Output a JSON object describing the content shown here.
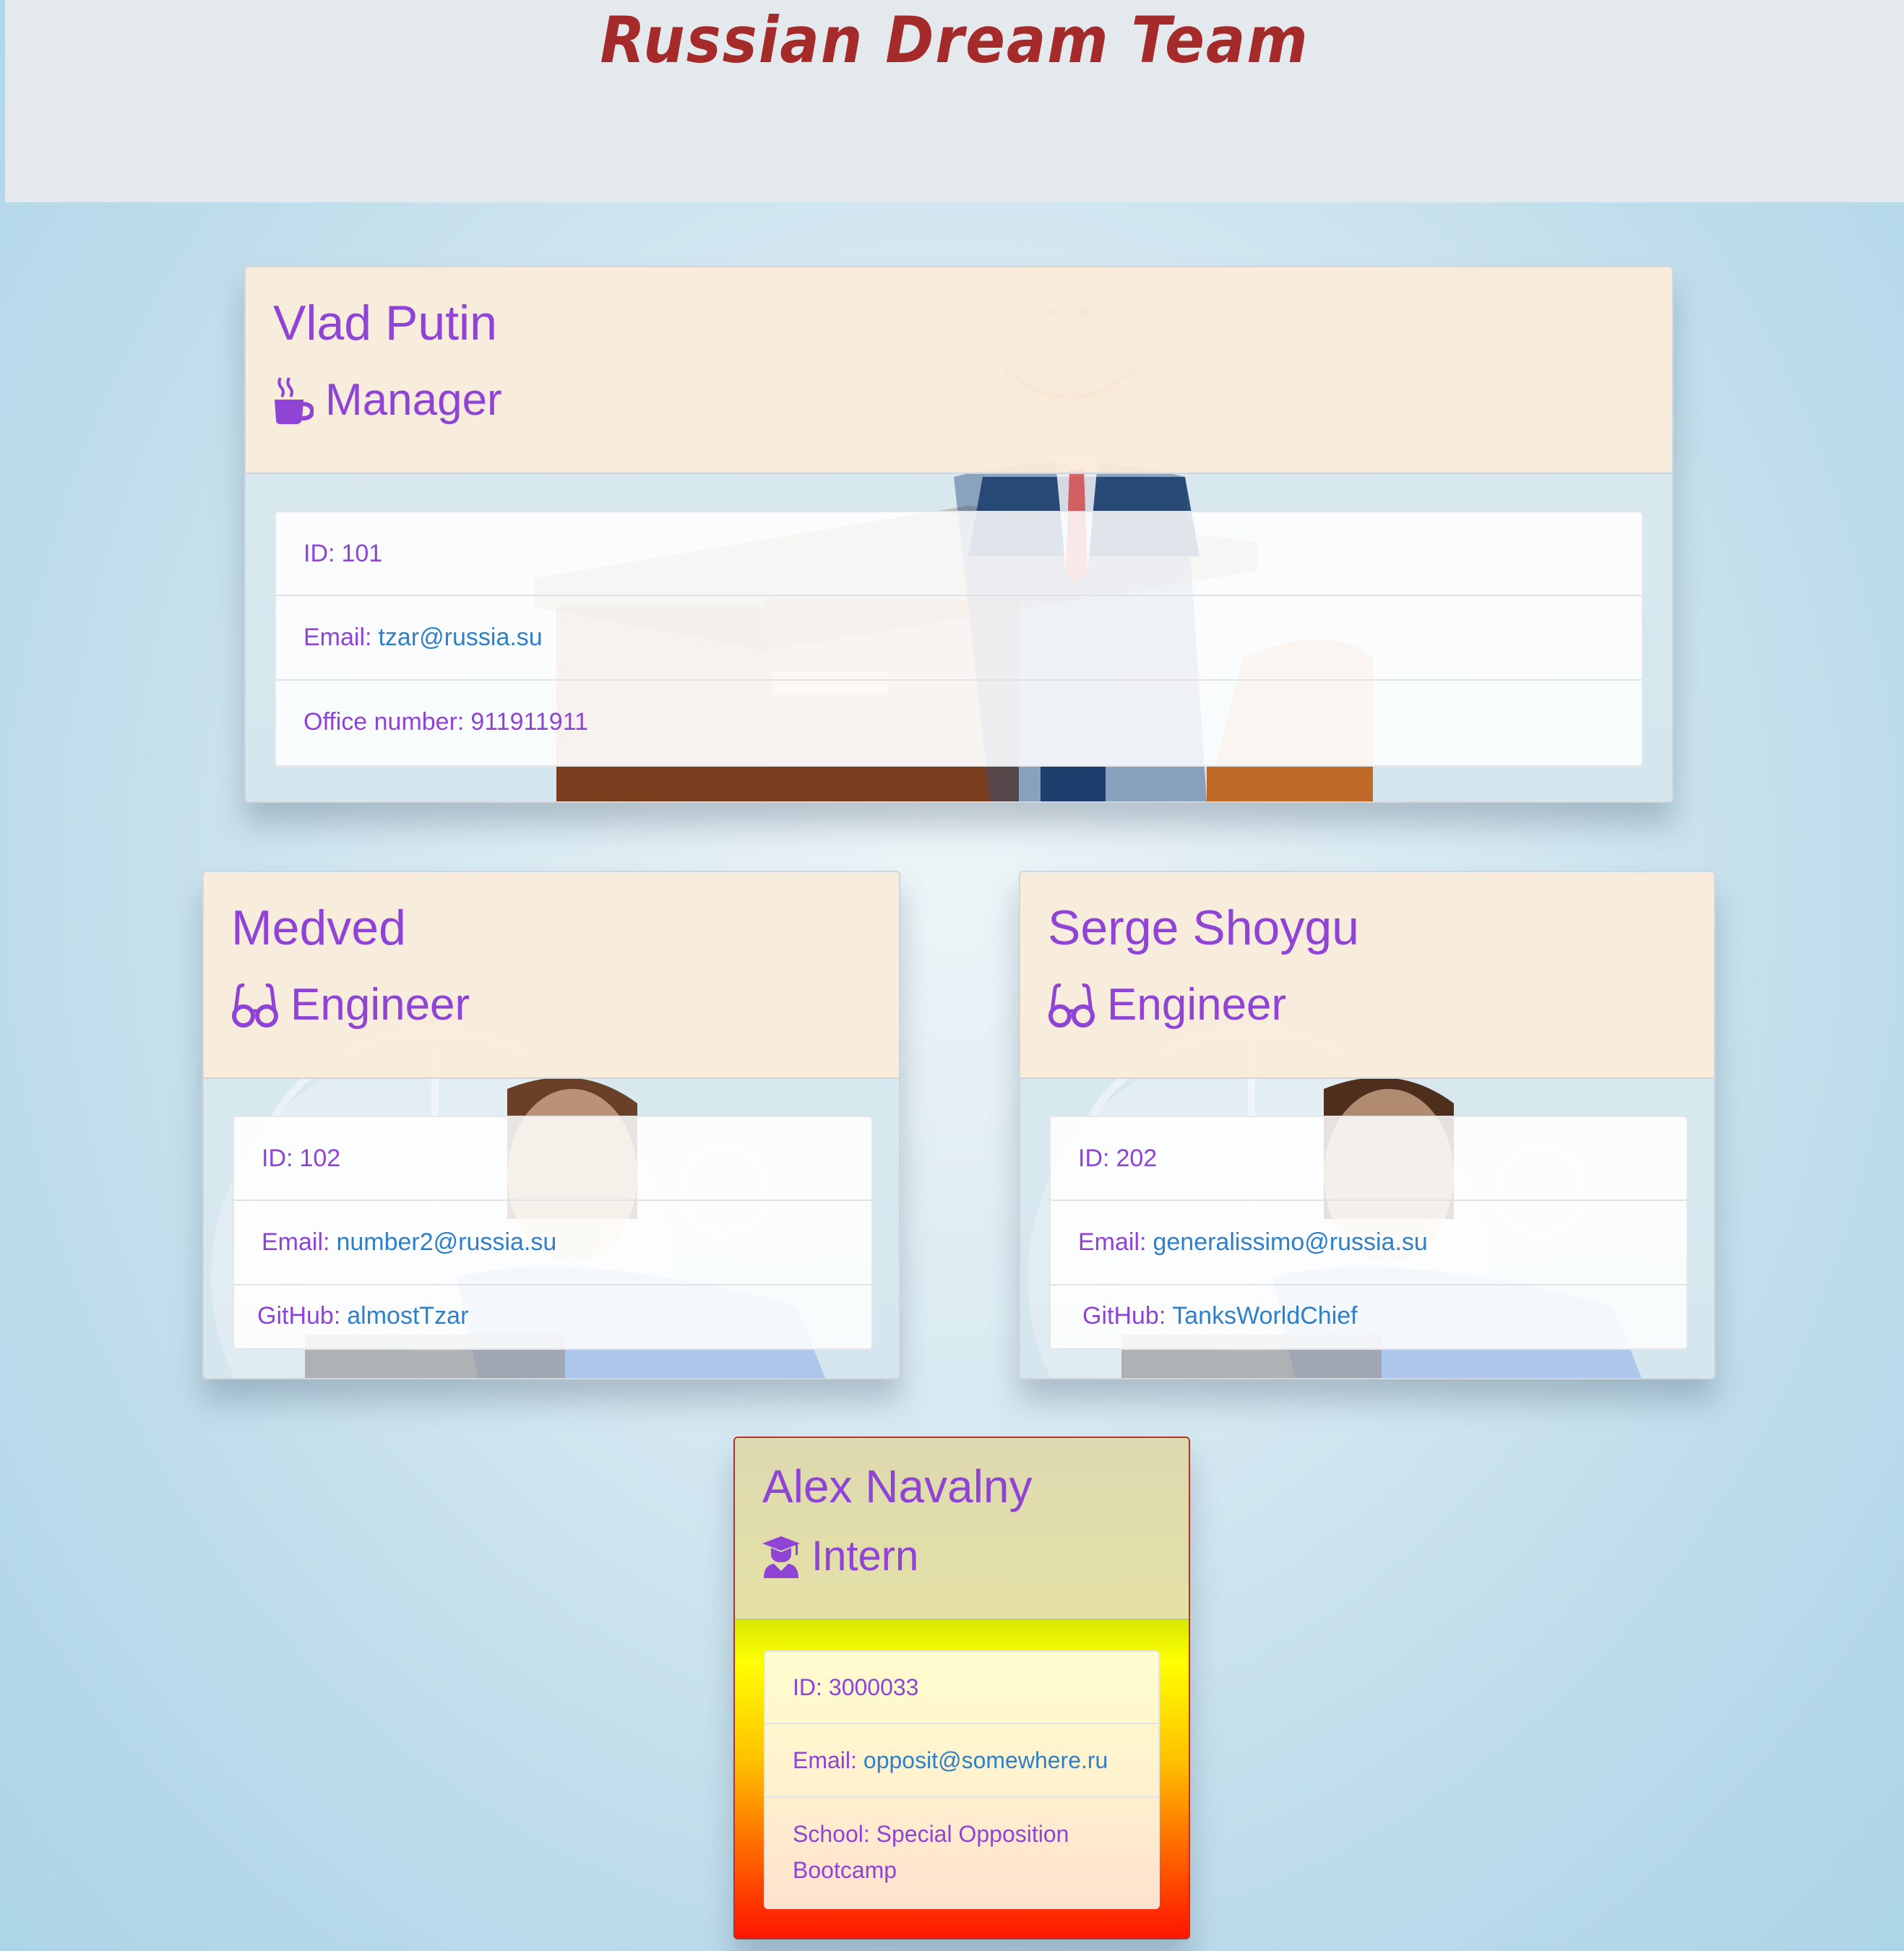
{
  "page_title": "Russian Dream Team",
  "colors": {
    "title": "#a52a2a",
    "name": "#8f44d6",
    "link": "#2f7fc9"
  },
  "cards": [
    {
      "name": "Vlad Putin",
      "role": "Manager",
      "role_icon": "mug-hot-icon",
      "id_label": "ID:",
      "id": "101",
      "email_label": "Email:",
      "email": "tzar@russia.su",
      "extra_label": "Office number:",
      "extra": "911911911"
    },
    {
      "name": "Medved",
      "role": "Engineer",
      "role_icon": "glasses-icon",
      "id_label": "ID:",
      "id": "102",
      "email_label": "Email:",
      "email": "number2@russia.su",
      "extra_label": "GitHub:",
      "extra": "almostTzar"
    },
    {
      "name": "Serge Shoygu",
      "role": "Engineer",
      "role_icon": "glasses-icon",
      "id_label": "ID:",
      "id": "202",
      "email_label": "Email:",
      "email": "generalissimo@russia.su",
      "extra_label": "GitHub:",
      "extra": "TanksWorldChief"
    },
    {
      "name": "Alex Navalny",
      "role": "Intern",
      "role_icon": "user-graduate-icon",
      "id_label": "ID:",
      "id": "3000033",
      "email_label": "Email:",
      "email": "opposit@somewhere.ru",
      "extra_label": "School:",
      "extra": "Special Opposition Bootcamp"
    }
  ]
}
